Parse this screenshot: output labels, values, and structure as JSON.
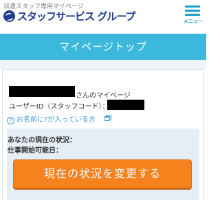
{
  "header": {
    "tagline": "派遣スタッフ専用マイページ",
    "logo_text": "スタッフサービス グループ",
    "menu_label": "メニュー"
  },
  "titlebar": {
    "title": "マイページトップ"
  },
  "profile": {
    "name_suffix": "さんのマイページ",
    "user_id_label": "ユーザーID（スタッフコード）：",
    "name_help_link": "お名前に?が入っている方"
  },
  "status": {
    "current_status_label": "あなたの現在の状況：",
    "start_date_label": "仕事開始可能日：",
    "change_button_label": "現在の状況を変更する"
  },
  "colors": {
    "brand_blue": "#1f3b8f",
    "accent_cyan": "#3cb8dc",
    "button_orange": "#f6821e",
    "link_blue": "#3a9bd6"
  }
}
